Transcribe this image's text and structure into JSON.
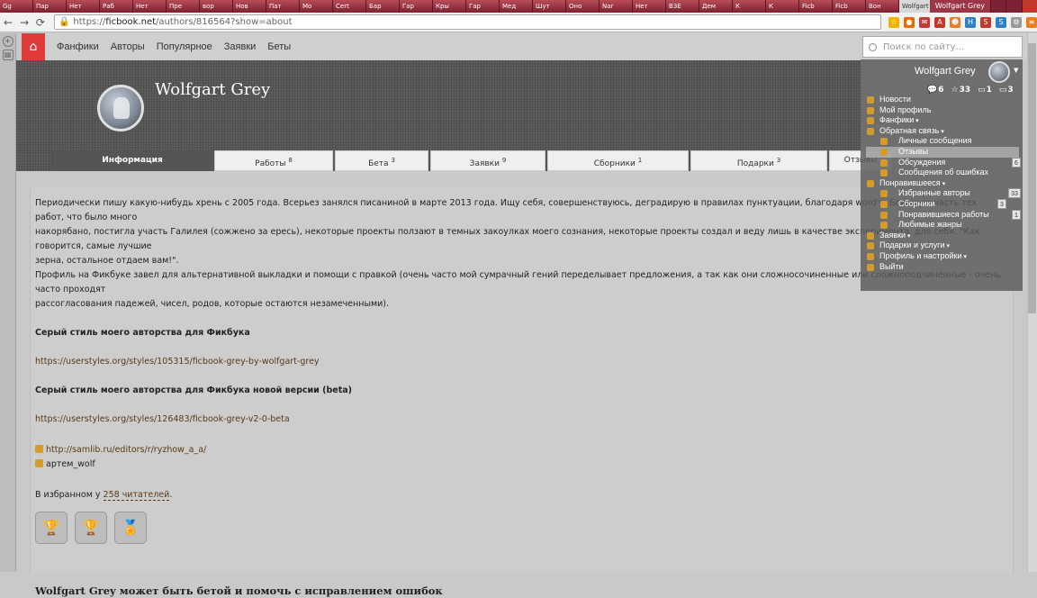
{
  "browser": {
    "tabs": [
      "Gg",
      "Пар",
      "Нет",
      "Раб",
      "Нет",
      "Пре",
      "вор",
      "Нов",
      "Пат",
      "Мо",
      "Cert",
      "Бар",
      "Гар",
      "Кры",
      "Гар",
      "Мед",
      "Шут",
      "Оно",
      "Nar",
      "Нет",
      "ВЗЕ",
      "Дем",
      "К",
      "К",
      "Ficb",
      "Ficb",
      "Вон",
      "Wolfgart Grey"
    ],
    "active_tab_index": 27,
    "window_title": "Wolfgart Grey",
    "url_host": "ficbook.net",
    "url_path": "/authors/816564?show=about",
    "url_scheme": "https://",
    "back_icon": "arrow-left-icon",
    "forward_icon": "arrow-right-icon",
    "reload_icon": "reload-icon",
    "ext_icons": [
      {
        "name": "star-icon",
        "color": "#f0b400",
        "glyph": "☆"
      },
      {
        "name": "ext-fox-icon",
        "color": "#e66b00",
        "glyph": "●"
      },
      {
        "name": "ext-mail-icon",
        "color": "#c23a3a",
        "glyph": "✉"
      },
      {
        "name": "ext-abp-icon",
        "color": "#c0392b",
        "glyph": "A"
      },
      {
        "name": "ext-people-icon",
        "color": "#e67e22",
        "glyph": "☻"
      },
      {
        "name": "ext-h-icon",
        "color": "#2f7fc1",
        "glyph": "H"
      },
      {
        "name": "ext-s-icon",
        "color": "#c0392b",
        "glyph": "S"
      },
      {
        "name": "ext-s2-icon",
        "color": "#2f7fc1",
        "glyph": "S"
      },
      {
        "name": "ext-settings-icon",
        "color": "#9a9a9a",
        "glyph": "⚙"
      },
      {
        "name": "menu-icon",
        "color": "#e67e22",
        "glyph": "≡"
      }
    ]
  },
  "site_nav": {
    "home_icon": "home-icon",
    "links": [
      "Фанфики",
      "Авторы",
      "Популярное",
      "Заявки",
      "Беты"
    ]
  },
  "profile": {
    "name": "Wolfgart Grey",
    "tabs": [
      {
        "label": "Информация",
        "count": ""
      },
      {
        "label": "Работы",
        "count": "8"
      },
      {
        "label": "Бета",
        "count": "3"
      },
      {
        "label": "Заявки",
        "count": "9"
      },
      {
        "label": "Сборники",
        "count": "1"
      },
      {
        "label": "Подарки",
        "count": "3"
      },
      {
        "label": "Отзывы",
        "count": ""
      }
    ]
  },
  "about": {
    "para1_line1": "Периодически пишу какую-нибудь хрень с 2005 года. Всерьез занялся писаниной в марте 2013 года. Ищу себя, совершенствуюсь, деградирую в правилах пунктуации, благодаря word'у. Большую часть тех работ, что было много",
    "para1_line2": "накорябано, постигла участь Галилея (сожжено за ересь), некоторые проекты ползают в темных закоулках моего сознания, некоторые проекты создал и веду лишь в качестве эксперимента, для себя. \"Как говорится, самые лучшие",
    "para1_line3": "зерна, остальное отдаем вам!\".",
    "para2_line1": "Профиль на Фикбуке завел для альтернативной выкладки и помощи с правкой (очень часто мой сумрачный гений переделывает предложения, а так как они сложносочиненные или сложноподчиненные - очень часто проходят",
    "para2_line2": "рассогласования падежей, чисел, родов, которые остаются незамеченными).",
    "style_title1": "Серый стиль моего авторства для Фикбука",
    "style_link1": "https://userstyles.org/styles/105315/ficbook-grey-by-wolfgart-grey",
    "style_title2": "Серый стиль моего авторства для Фикбука новой версии (beta)",
    "style_link2": "https://userstyles.org/styles/126483/ficbook-grey-v2-0-beta",
    "samlib_link": "http://samlib.ru/editors/r/ryzhow_a_a/",
    "skype_name": "артем_wolf",
    "favorites_prefix": "В избранном у ",
    "favorites_count": "258 читателей",
    "favorites_suffix": ".",
    "awards": [
      {
        "icon": "trophy-icon",
        "glyph": "🏆"
      },
      {
        "icon": "trophy-icon",
        "glyph": "🏆"
      },
      {
        "icon": "medal-icon",
        "glyph": "🏅"
      }
    ],
    "beta_heading": "Wolfgart Grey может быть бетой и помочь с исправлением ошибок"
  },
  "search": {
    "placeholder": "Поиск по сайту..."
  },
  "user_menu": {
    "username": "Wolfgart Grey",
    "stats": [
      {
        "icon": "comments-icon",
        "glyph": "💬",
        "value": "6"
      },
      {
        "icon": "star-icon",
        "glyph": "☆",
        "value": "33"
      },
      {
        "icon": "message-icon",
        "glyph": "▭",
        "value": "1"
      },
      {
        "icon": "message-icon",
        "glyph": "▭",
        "value": "3"
      }
    ],
    "items": [
      {
        "label": "Новости",
        "sub": false,
        "hl": false,
        "badge": ""
      },
      {
        "label": "Мой профиль",
        "sub": false,
        "hl": false,
        "badge": ""
      },
      {
        "label": "Фанфики",
        "sub": false,
        "hl": false,
        "badge": "",
        "caret": true
      },
      {
        "label": "Обратная связь",
        "sub": false,
        "hl": false,
        "badge": "",
        "caret": true
      },
      {
        "label": "Личные сообщения",
        "sub": true,
        "hl": false,
        "badge": ""
      },
      {
        "label": "Отзывы",
        "sub": true,
        "hl": true,
        "badge": ""
      },
      {
        "label": "Обсуждения",
        "sub": true,
        "hl": false,
        "badge": "6"
      },
      {
        "label": "Сообщения об ошибках",
        "sub": true,
        "hl": false,
        "badge": ""
      },
      {
        "label": "Понравившееся",
        "sub": false,
        "hl": false,
        "badge": "",
        "caret": true
      },
      {
        "label": "Избранные авторы",
        "sub": true,
        "hl": false,
        "badge": "33"
      },
      {
        "label": "Сборники",
        "sub": true,
        "hl": false,
        "badge": "3"
      },
      {
        "label": "Понравившиеся работы",
        "sub": true,
        "hl": false,
        "badge": "1"
      },
      {
        "label": "Любимые жанры",
        "sub": true,
        "hl": false,
        "badge": ""
      },
      {
        "label": "Заявки",
        "sub": false,
        "hl": false,
        "badge": "",
        "caret": true
      },
      {
        "label": "Подарки и услуги",
        "sub": false,
        "hl": false,
        "badge": "",
        "caret": true
      },
      {
        "label": "Профиль и настройки",
        "sub": false,
        "hl": false,
        "badge": "",
        "caret": true
      },
      {
        "label": "Выйти",
        "sub": false,
        "hl": false,
        "badge": ""
      }
    ]
  }
}
